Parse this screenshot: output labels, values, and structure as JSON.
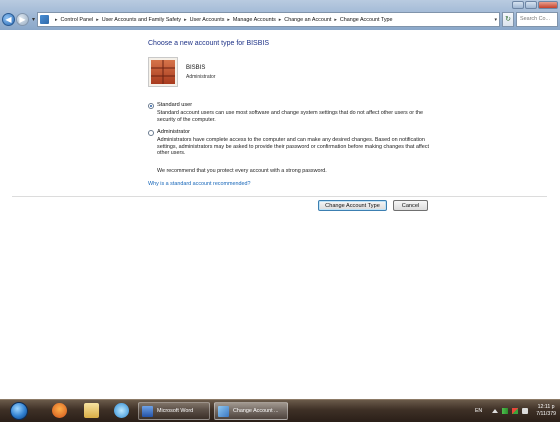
{
  "window": {
    "breadcrumbs": [
      "Control Panel",
      "User Accounts and Family Safety",
      "User Accounts",
      "Manage Accounts",
      "Change an Account",
      "Change Account Type"
    ],
    "search_placeholder": "Search Co..."
  },
  "main": {
    "heading": "Choose a new account type for BISBIS",
    "user": {
      "name": "BISBIS",
      "role": "Administrator"
    },
    "options": [
      {
        "label": "Standard user",
        "selected": true,
        "description": "Standard account users can use most software and change system settings that do not affect other users or the security of the computer."
      },
      {
        "label": "Administrator",
        "selected": false,
        "description": "Administrators have complete access to the computer and can make any desired changes. Based on notification settings, administrators may be asked to provide their password or confirmation before making changes that affect other users."
      }
    ],
    "recommendation": "We recommend that you protect every account with a strong password.",
    "help_link": "Why is a standard account recommended?",
    "buttons": {
      "change": "Change Account Type",
      "cancel": "Cancel"
    }
  },
  "taskbar": {
    "tasks": [
      {
        "label": "Microsoft Word",
        "icon": "word-icon"
      },
      {
        "label": "Change Account ...",
        "icon": "control-panel-icon"
      }
    ],
    "tray": {
      "language": "EN",
      "time": "12:11 p",
      "date": "7/11/379"
    }
  }
}
